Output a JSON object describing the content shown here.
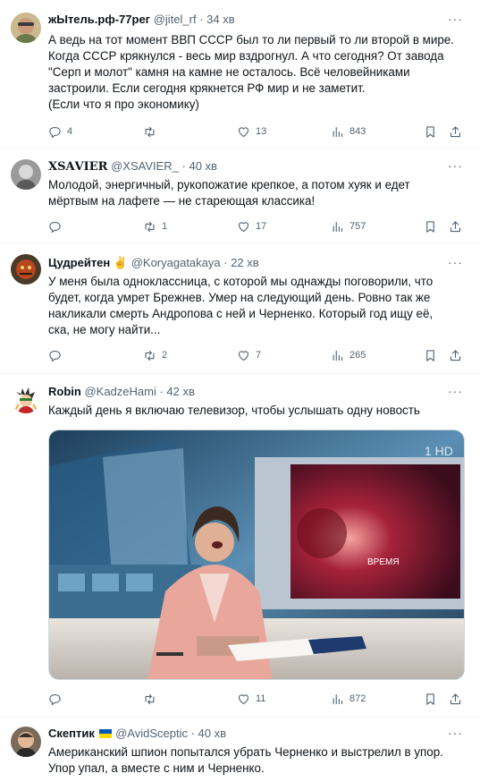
{
  "tweets": [
    {
      "name": "жЫтель.рф-77рег",
      "handle": "@jitel_rf",
      "time": "· 34 хв",
      "text": "А ведь на тот момент ВВП СССР был то ли первый то ли второй в мире.\nКогда СССР крякнулся - весь мир вздрогнул. А что сегодня? От завода\n\"Серп и молот\" камня на камне не осталось. Всё человейниками\nзастроили. Если сегодня крякнется РФ мир и не заметит.\n(Если что я про экономику)",
      "replies": "4",
      "retweets": "",
      "likes": "13",
      "views": "843"
    },
    {
      "name": "𝐗𝐒𝐀𝐕𝐈𝐄𝐑",
      "handle": "@XSAVIER_",
      "time": "· 40 хв",
      "text": "Молодой, энергичный, рукопожатие крепкое, а потом хуяк и едет\nмёртвым на лафете — не стареющая классика!",
      "replies": "",
      "retweets": "1",
      "likes": "17",
      "views": "757"
    },
    {
      "name": "Цудрейтен ✌",
      "handle": "@Koryagatakaya",
      "time": "· 22 хв",
      "text": "У меня была одноклассница, с которой мы однажды поговорили, что\nбудет, когда умрет Брежнев. Умер на следующий день. Ровно так же\nнакликали смерть Андропова с ней и Черненко. Который год ищу её,\nска, не могу найти...",
      "replies": "",
      "retweets": "2",
      "likes": "7",
      "views": "265"
    },
    {
      "name": "Robin",
      "handle": "@KadzeHami",
      "time": "· 42 хв",
      "text": "Каждый день я включаю телевизор, чтобы услышать одну новость",
      "media_label": "ВРЕМЯ",
      "replies": "",
      "retweets": "",
      "likes": "11",
      "views": "872"
    },
    {
      "name": "Скептик",
      "handle": "@AvidSceptic",
      "time": "· 40 хв",
      "text": "Американский шпион попытался убрать Черненко и выстрелил в упор.\nУпор упал, а вместе с ним и Черненко."
    }
  ],
  "icons": {
    "reply": "reply-icon",
    "retweet": "retweet-icon",
    "like": "heart-icon",
    "views": "views-icon",
    "bookmark": "bookmark-icon",
    "share": "share-icon",
    "more": "more-icon"
  },
  "colors": {
    "text": "#0f1419",
    "secondary": "#536471",
    "divider": "#eff3f4"
  }
}
